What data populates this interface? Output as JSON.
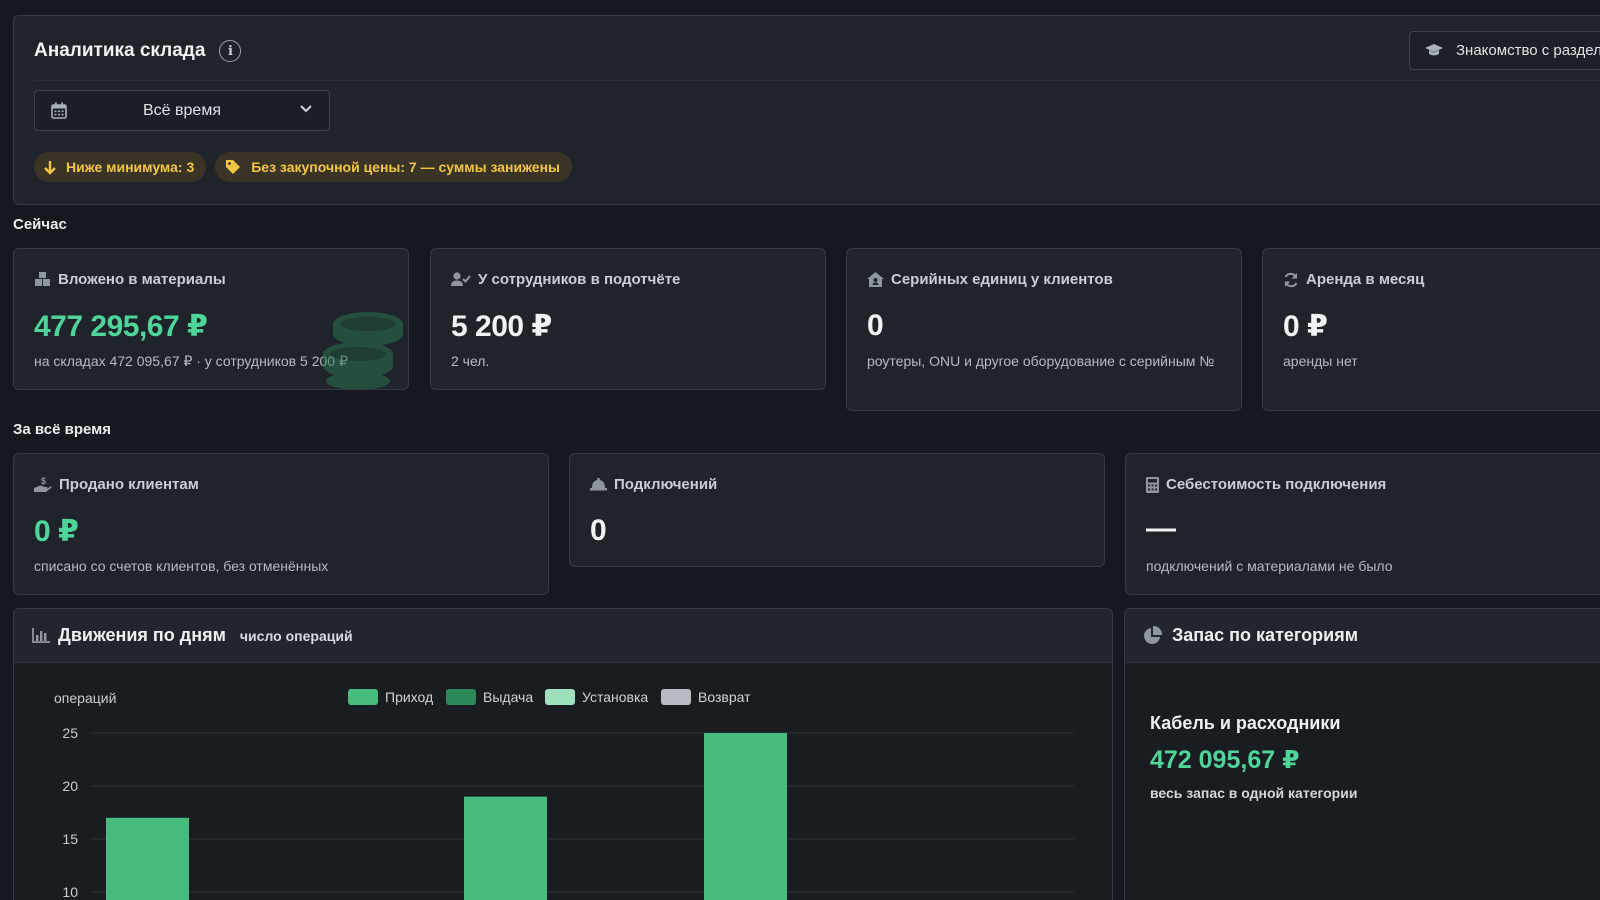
{
  "header": {
    "title": "Аналитика склада",
    "guide_button": "Знакомство с раздел",
    "period_select": {
      "value": "Всё время"
    },
    "chips": [
      {
        "label": "Ниже минимума: 3",
        "icon": "arrow-down-icon"
      },
      {
        "label": "Без закупочной цены: 7 — суммы занижены",
        "icon": "tag-icon"
      }
    ]
  },
  "now_section": {
    "label": "Сейчас",
    "cards": [
      {
        "title": "Вложено в материалы",
        "icon": "boxes-icon",
        "value": "477 295,67 ₽",
        "sub": "на складах 472 095,67 ₽ · у сотрудников 5 200 ₽"
      },
      {
        "title": "У сотрудников в подотчёте",
        "icon": "user-check-icon",
        "value": "5 200 ₽",
        "sub": "2 чел."
      },
      {
        "title": "Серийных единиц у клиентов",
        "icon": "house-user-icon",
        "value": "0",
        "sub": "роутеры, ONU и другое оборудование с серийным №"
      },
      {
        "title": "Аренда в месяц",
        "icon": "refresh-icon",
        "value": "0 ₽",
        "sub": "аренды нет"
      }
    ]
  },
  "alltime_section": {
    "label": "За всё время",
    "cards": [
      {
        "title": "Продано клиентам",
        "icon": "hand-dollar-icon",
        "value": "0 ₽",
        "sub": "списано со счетов клиентов, без отменённых"
      },
      {
        "title": "Подключений",
        "icon": "hardhat-icon",
        "value": "0",
        "sub": ""
      },
      {
        "title": "Себестоимость подключения",
        "icon": "calculator-icon",
        "value": "—",
        "sub": "подключений с материалами не было"
      }
    ]
  },
  "movements": {
    "title": "Движения по дням",
    "subtitle": "число операций"
  },
  "categories": {
    "title": "Запас по категориям",
    "category_name": "Кабель и расходники",
    "category_value": "472 095,67 ₽",
    "note": "весь запас в одной категории"
  },
  "colors": {
    "accent_green": "#4fd49a",
    "warning_yellow": "#f4c542",
    "series_prihod": "#46bb7d",
    "series_vydacha": "#2c8a5a",
    "series_ustanovka": "#9ee0bc",
    "series_vozvrat": "#b8bcc2"
  },
  "chart_data": {
    "type": "bar",
    "ylabel": "операций",
    "yticks": [
      10,
      15,
      20,
      25
    ],
    "ylim": [
      0,
      25
    ],
    "legend_position": "top",
    "grid": true,
    "series": [
      {
        "name": "Приход",
        "values": [
          17,
          19,
          25
        ]
      },
      {
        "name": "Выдача",
        "values": []
      },
      {
        "name": "Установка",
        "values": []
      },
      {
        "name": "Возврат",
        "values": []
      }
    ]
  }
}
